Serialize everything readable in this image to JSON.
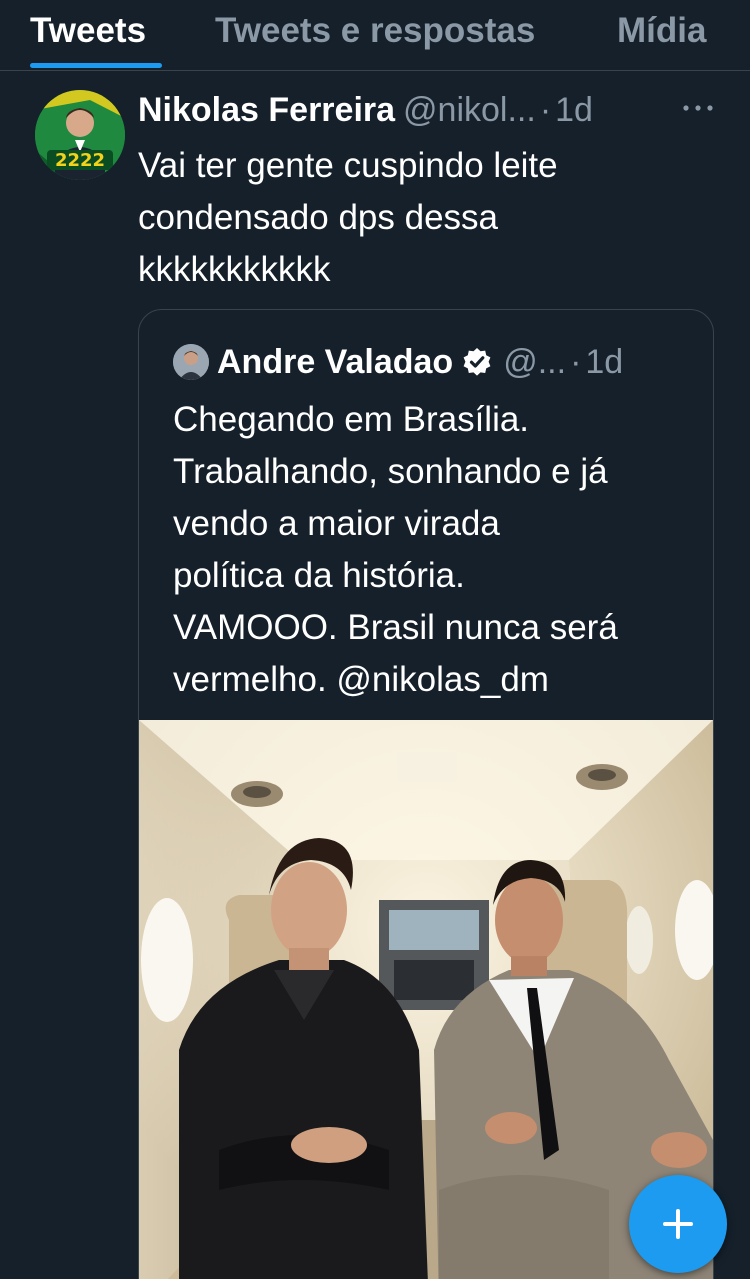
{
  "tabs": [
    {
      "label": "Tweets",
      "active": true
    },
    {
      "label": "Tweets e respostas",
      "active": false
    },
    {
      "label": "Mídia",
      "active": false
    }
  ],
  "tweet": {
    "author_name": "Nikolas Ferreira",
    "author_handle": "@nikol...",
    "separator": "·",
    "timestamp": "1d",
    "avatar_badge": "2222",
    "text": "Vai ter gente cuspindo leite\ncondensado dps dessa\nkkkkkkkkkkk",
    "more_icon": "more-horizontal-icon",
    "quote": {
      "author_name": "Andre Valadao",
      "verified": true,
      "verified_icon": "verified-badge-icon",
      "author_handle": "@...",
      "separator": "·",
      "timestamp": "1d",
      "text": "Chegando em Brasília.\nTrabalhando, sonhando e já\nvendo a maior virada\npolítica da história.\nVAMOOO. Brasil nunca será\nvermelho. @nikolas_dm"
    }
  },
  "compose_button": {
    "icon": "plus-icon"
  },
  "colors": {
    "background": "#15202b",
    "divider": "#38444d",
    "accent": "#1d9bf0",
    "secondary_text": "#8b98a5",
    "primary_text": "#ffffff"
  }
}
